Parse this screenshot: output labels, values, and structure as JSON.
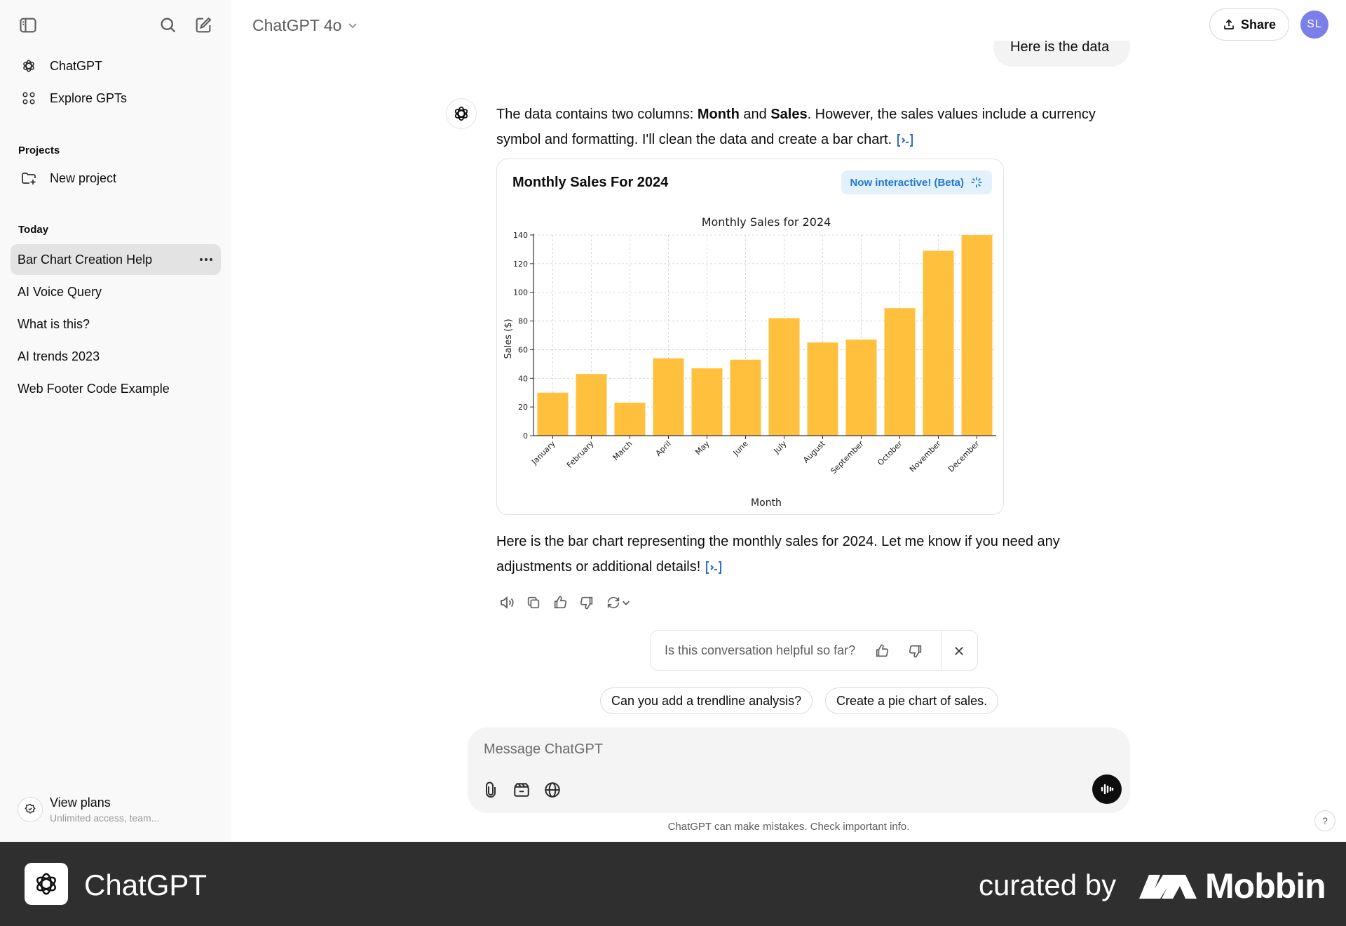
{
  "sidebar": {
    "nav": [
      {
        "label": "ChatGPT",
        "icon": "chatgpt-logo-icon"
      },
      {
        "label": "Explore GPTs",
        "icon": "grid-icon"
      }
    ],
    "projects_heading": "Projects",
    "new_project": "New project",
    "today_heading": "Today",
    "chats": [
      {
        "label": "Bar Chart Creation Help",
        "active": true
      },
      {
        "label": "AI Voice Query",
        "active": false
      },
      {
        "label": "What is this?",
        "active": false
      },
      {
        "label": "AI trends 2023",
        "active": false
      },
      {
        "label": "Web Footer Code Example",
        "active": false
      }
    ],
    "view_plans": {
      "title": "View plans",
      "subtitle": "Unlimited access, team..."
    }
  },
  "header": {
    "model": "ChatGPT 4o",
    "share": "Share",
    "avatar_initials": "SL"
  },
  "conversation": {
    "user_message": "Here is the data",
    "assistant_intro_pre": "The data contains two columns: ",
    "assistant_intro_b1": "Month",
    "assistant_intro_mid": " and ",
    "assistant_intro_b2": "Sales",
    "assistant_intro_post": ". However, the sales values include a currency symbol and formatting. I'll clean the data and create a bar chart.",
    "assistant_outro": "Here is the bar chart representing the monthly sales for 2024. Let me know if you need any adjustments or additional details!"
  },
  "chart_card": {
    "title": "Monthly Sales For 2024",
    "badge": "Now interactive! (Beta)"
  },
  "chart_data": {
    "type": "bar",
    "title": "Monthly Sales for 2024",
    "xlabel": "Month",
    "ylabel": "Sales ($)",
    "categories": [
      "January",
      "February",
      "March",
      "April",
      "May",
      "June",
      "July",
      "August",
      "September",
      "October",
      "November",
      "December"
    ],
    "values": [
      30,
      43,
      23,
      54,
      47,
      53,
      82,
      65,
      67,
      89,
      129,
      140
    ],
    "ylim": [
      0,
      140
    ],
    "yticks": [
      0,
      20,
      40,
      60,
      80,
      100,
      120,
      140
    ],
    "grid": true,
    "color": "#ffc13d"
  },
  "feedback": {
    "question": "Is this conversation helpful so far?"
  },
  "suggestions": [
    "Can you add a trendline analysis?",
    "Create a pie chart of sales."
  ],
  "composer": {
    "placeholder": "Message ChatGPT"
  },
  "disclaimer": "ChatGPT can make mistakes. Check important info.",
  "help": "?",
  "banner": {
    "app_name": "ChatGPT",
    "curated_by": "curated by",
    "brand": "Mobbin"
  }
}
